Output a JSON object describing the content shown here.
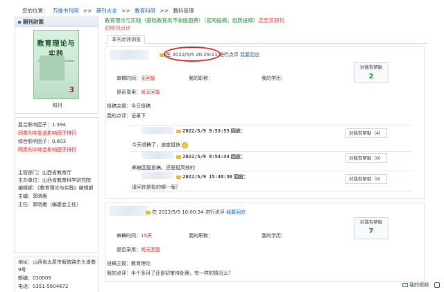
{
  "breadcrumb": {
    "prefix": "您的位置：",
    "items": [
      "万维书刊网",
      ">>",
      "期刊大全",
      ">>",
      "教育科研",
      ">>",
      "教科管理"
    ]
  },
  "left": {
    "cover_header": "期刊封面",
    "cover_title": "教育理论与实践",
    "cover_subtitle": "Theory and Practice of Education",
    "cover_issue": "3",
    "cover_label": "旬刊",
    "stats": [
      "复合影响因子：1.394",
      "同类刊中复合影响因子排行",
      "综合影响因子：0.603",
      "同类刊中综合影响因子排行"
    ],
    "info": [
      "主管部门：山西省教育厅",
      "主办单位：山西省教育科学研究院",
      "编辑部：《教育理论与实践》编辑部",
      "主编：郭晓雁",
      "主任：郭晓雁（编委会主任）"
    ],
    "contact": [
      "地址：山西省太原市解放路东头道巷9号",
      "邮编：030009",
      "电话：0351-5604672"
    ]
  },
  "main": {
    "title_part1": "教育理论与实践（基础教育类不收版面费）（官网投稿；纸质投稿）",
    "title_link": "选至该期刊",
    "title_line2": "的期刊点评",
    "tab": "本刊点评浏览"
  },
  "review1": {
    "date_prefix": "在",
    "datetime": "2022/5/5 20:29:11",
    "action": "进行点评",
    "reply_link": "我要回应",
    "review_time_label": "审稿时间：",
    "review_time_value": "无回复",
    "title_label": "我的职称：",
    "edu_label": "我的学历：",
    "accepted_label": "是否录用：",
    "accepted_value": "尚无回复",
    "topic_label": "投稿主题：",
    "topic_value": "今日投稿",
    "comment_label": "我的点评：",
    "comment_value": "记录下",
    "helpful_label": "对我有帮助",
    "helpful_count": "2"
  },
  "replies": [
    {
      "datetime": "2022/5/9 9:53:55",
      "label": "回应：",
      "text": "今天退稿了，速度挺快",
      "helpful": "对我有帮助（4）"
    },
    {
      "datetime": "2022/5/9 9:54:44",
      "label": "回应：",
      "text": "邮箱回复投稿，还是挺高效的",
      "helpful": "对我有帮助（0）"
    },
    {
      "datetime": "2022/5/9 15:48:30",
      "label": "回应：",
      "text": "请问你是投的哪一版？",
      "helpful": "对我有帮助（0）"
    }
  ],
  "review2": {
    "date_prefix": "在",
    "datetime": "2022/5/5 10:00:34",
    "action": "进行点评",
    "reply_link": "我要回应",
    "review_time_label": "审稿时间：",
    "review_time_value": "15天",
    "title_label": "我的职称：",
    "edu_label": "我的学历：",
    "accepted_label": "是否录用：",
    "accepted_value": "尚无回复",
    "topic_label": "投稿主题：",
    "topic_value": "教育理论",
    "comment_label": "我的点评：",
    "comment_value": "半个多月了还是初审待处理，有一样的情况么？",
    "helpful_label": "对我有帮助",
    "helpful_count": "7"
  },
  "footer": {
    "label": "我的视频"
  }
}
